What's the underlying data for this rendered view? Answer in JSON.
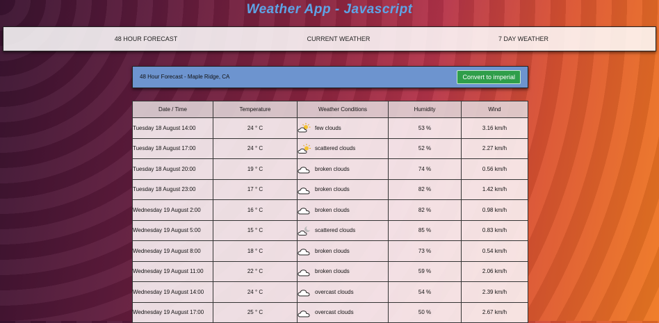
{
  "app": {
    "title": "Weather App - Javascript"
  },
  "nav": [
    {
      "label": "48 HOUR FORECAST"
    },
    {
      "label": "CURRENT WEATHER"
    },
    {
      "label": "7 DAY WEATHER"
    }
  ],
  "forecast": {
    "title": "48 Hour Forecast - Maple Ridge, CA",
    "convert_label": "Convert to imperial"
  },
  "table": {
    "headers": [
      "Date / Time",
      "Temperature",
      "Weather Conditions",
      "Humidity",
      "Wind"
    ],
    "rows": [
      {
        "date": "Tuesday 18 August 14:00",
        "temp": "24 ° C",
        "icon": "few-clouds-icon",
        "cond": "few clouds",
        "hum": "53 %",
        "wind": "3.16 km/h"
      },
      {
        "date": "Tuesday 18 August 17:00",
        "temp": "24 ° C",
        "icon": "scattered-clouds-sun-icon",
        "cond": "scattered clouds",
        "hum": "52 %",
        "wind": "2.27 km/h"
      },
      {
        "date": "Tuesday 18 August 20:00",
        "temp": "19 ° C",
        "icon": "cloud-icon",
        "cond": "broken clouds",
        "hum": "74 %",
        "wind": "0.56 km/h"
      },
      {
        "date": "Tuesday 18 August 23:00",
        "temp": "17 ° C",
        "icon": "cloud-icon",
        "cond": "broken clouds",
        "hum": "82 %",
        "wind": "1.42 km/h"
      },
      {
        "date": "Wednesday 19 August 2:00",
        "temp": "16 ° C",
        "icon": "cloud-icon",
        "cond": "broken clouds",
        "hum": "82 %",
        "wind": "0.98 km/h"
      },
      {
        "date": "Wednesday 19 August 5:00",
        "temp": "15 ° C",
        "icon": "scattered-clouds-moon-icon",
        "cond": "scattered clouds",
        "hum": "85 %",
        "wind": "0.83 km/h"
      },
      {
        "date": "Wednesday 19 August 8:00",
        "temp": "18 ° C",
        "icon": "cloud-icon",
        "cond": "broken clouds",
        "hum": "73 %",
        "wind": "0.54 km/h"
      },
      {
        "date": "Wednesday 19 August 11:00",
        "temp": "22 ° C",
        "icon": "cloud-icon",
        "cond": "broken clouds",
        "hum": "59 %",
        "wind": "2.06 km/h"
      },
      {
        "date": "Wednesday 19 August 14:00",
        "temp": "24 ° C",
        "icon": "cloud-icon",
        "cond": "overcast clouds",
        "hum": "54 %",
        "wind": "2.39 km/h"
      },
      {
        "date": "Wednesday 19 August 17:00",
        "temp": "25 ° C",
        "icon": "cloud-icon",
        "cond": "overcast clouds",
        "hum": "50 %",
        "wind": "2.67 km/h"
      }
    ]
  }
}
